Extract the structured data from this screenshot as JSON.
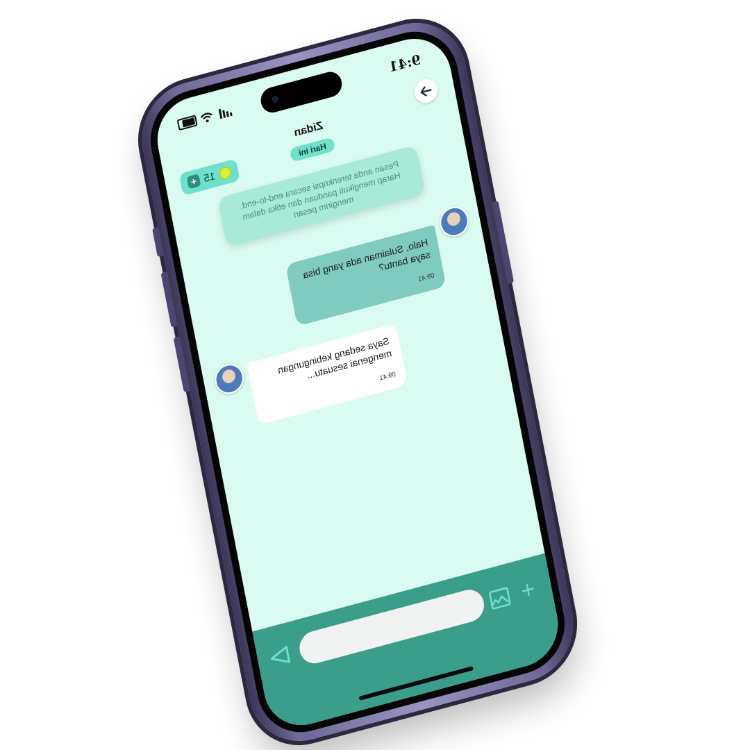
{
  "status_bar": {
    "time": "9:41"
  },
  "header": {
    "contact_name": "Zidan",
    "date_label": "Hari ini",
    "coin_count": "15",
    "coin_add_label": "+"
  },
  "system_note": {
    "text": "Pesan anda terenkripsi secara end-to-end. Harap mengikuti panduan dan etika dalam mengirim pesan"
  },
  "messages": [
    {
      "direction": "outgoing",
      "text": "Halo, Sulaiman ada yang bisa saya bantu?",
      "time": "09:41"
    },
    {
      "direction": "incoming",
      "text": "Saya sedang kebingungan mengenai sesuatu...",
      "time": "09:41"
    }
  ],
  "composer": {
    "input_value": "",
    "add_label": "+"
  },
  "colors": {
    "screen_bg": "#dafbf1",
    "accent": "#6fe0cb",
    "composer_bg": "#3a9e8b",
    "outgoing_bubble": "#7fcbbf",
    "incoming_bubble": "#ffffff"
  },
  "icons": {
    "back": "arrow-right-icon",
    "coin": "coin-icon",
    "image": "image-icon",
    "send": "send-icon",
    "add": "plus-icon"
  }
}
